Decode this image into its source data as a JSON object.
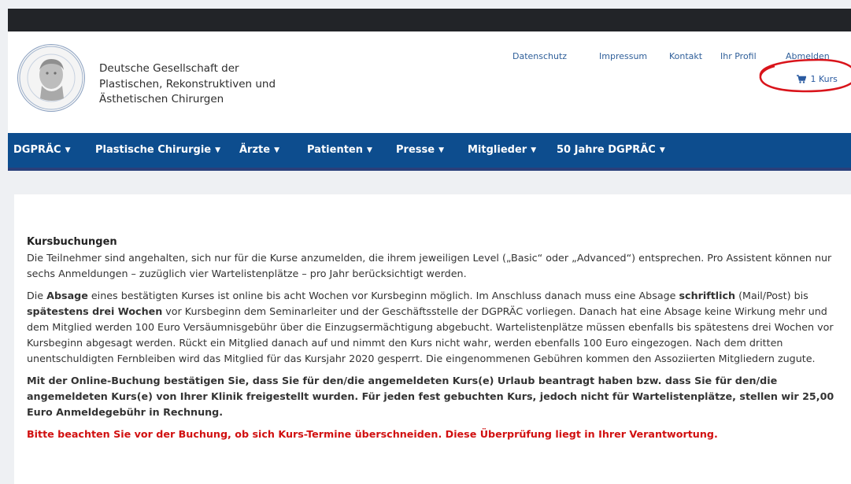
{
  "header": {
    "org_name_lines": [
      "Deutsche Gesellschaft der",
      "Plastischen, Rekonstruktiven und",
      "Ästhetischen Chirurgen"
    ],
    "top_links": [
      "Datenschutz",
      "Impressum",
      "Kontakt",
      "Ihr Profil",
      "Abmelden"
    ],
    "cart_label": "1 Kurs",
    "annotation_color": "#d9141b"
  },
  "nav": {
    "items": [
      "DGPRÄC",
      "Plastische Chirurgie",
      "Ärzte",
      "Patienten",
      "Presse",
      "Mitglieder",
      "50 Jahre DGPRÄC"
    ],
    "caret": "▼"
  },
  "content": {
    "heading": "Kursbuchungen",
    "p1": "Die Teilnehmer sind angehalten, sich nur für die Kurse anzumelden, die ihrem jeweiligen Level („Basic“ oder „Advanced“) entsprechen. Pro Assistent können nur sechs Anmeldungen – zuzüglich vier Wartelistenplätze – pro Jahr berücksichtigt werden.",
    "p2": {
      "a": "Die ",
      "b": "Absage",
      "c": " eines bestätigten Kurses ist online bis acht Wochen vor Kursbeginn möglich. Im Anschluss danach muss eine Absage ",
      "d": "schriftlich",
      "e": " (Mail/Post) bis ",
      "f": "spätestens drei Wochen",
      "g": " vor Kursbeginn dem Seminarleiter und der Geschäftsstelle der DGPRÄC vorliegen. Danach hat eine Absage keine Wirkung mehr und dem Mitglied werden 100 Euro Versäumnisgebühr über die Einzugsermächtigung abgebucht. Wartelistenplätze müssen ebenfalls bis spätestens drei Wochen vor Kursbeginn abgesagt werden. Rückt ein Mitglied danach auf und nimmt den Kurs nicht wahr, werden ebenfalls 100 Euro eingezogen. Nach dem dritten unentschuldigten Fernbleiben wird das Mitglied für das Kursjahr 2020 gesperrt. Die eingenommenen Gebühren kommen den Assoziierten Mitgliedern zugute."
    },
    "p3": "Mit der Online-Buchung bestätigen Sie, dass Sie für den/die angemeldeten Kurs(e) Urlaub beantragt haben bzw. dass Sie für den/die angemeldeten Kurs(e) von Ihrer Klinik freigestellt wurden. Für jeden fest gebuchten Kurs, jedoch nicht für Wartelistenplätze, stellen wir 25,00 Euro Anmeldegebühr in Rechnung.",
    "p4": "Bitte beachten Sie vor der Buchung, ob sich Kurs-Termine überschneiden. Diese Überprüfung liegt in Ihrer Verantwortung."
  }
}
